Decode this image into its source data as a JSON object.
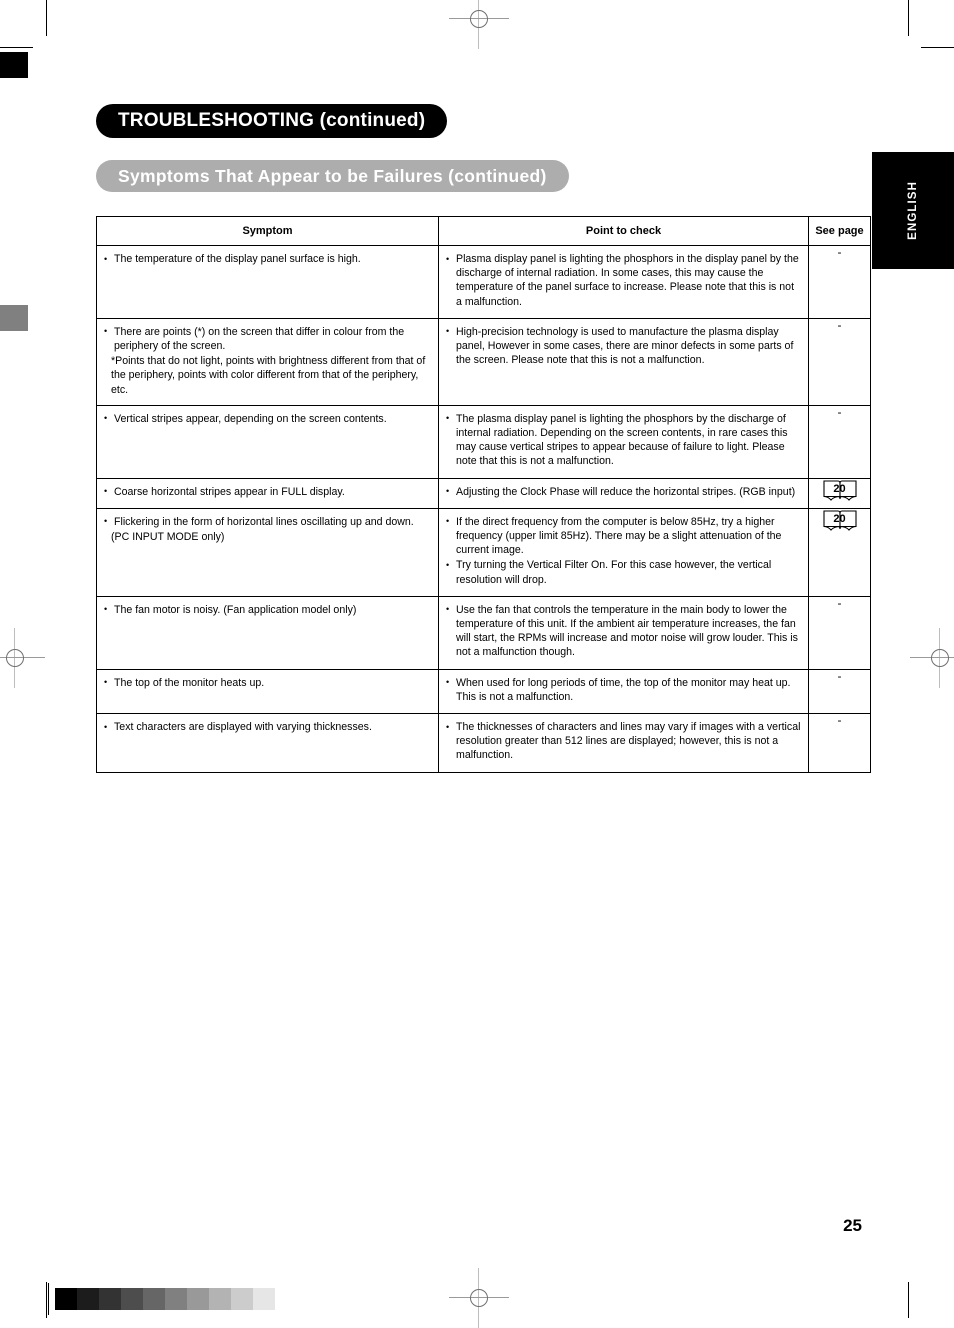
{
  "header": {
    "title": "TROUBLESHOOTING (continued)",
    "subtitle": "Symptoms That Appear to be Failures (continued)"
  },
  "side_tab": {
    "label": "ENGLISH"
  },
  "table": {
    "columns": [
      "Symptom",
      "Point to check",
      "See page"
    ],
    "rows": [
      {
        "symptom": [
          "The temperature of the display panel surface is high."
        ],
        "symptom_notes": [],
        "point": [
          "Plasma display panel is lighting the phosphors in the display panel by the discharge of internal radiation. In some cases, this may cause the temperature of the panel surface to increase. Please note that this is not a malfunction."
        ],
        "page": "-",
        "page_type": "dash"
      },
      {
        "symptom": [
          "There are points (*) on the screen that differ in colour from the periphery of the screen."
        ],
        "symptom_notes": [
          "*Points that do not light, points with brightness different from that of the periphery, points with color different from that of the periphery, etc."
        ],
        "point": [
          "High-precision technology is used to manufacture the plasma display panel, However in some cases, there are minor defects in some parts of the screen. Please note that this is not a malfunction."
        ],
        "page": "-",
        "page_type": "dash"
      },
      {
        "symptom": [
          "Vertical stripes appear, depending on the screen contents."
        ],
        "symptom_notes": [],
        "point": [
          "The plasma display panel is lighting the phosphors by the discharge of internal radiation. Depending on the screen contents, in rare cases this may cause vertical stripes to appear because of failure to light. Please note that this is not a malfunction."
        ],
        "page": "-",
        "page_type": "dash"
      },
      {
        "symptom": [
          "Coarse horizontal stripes appear in FULL display."
        ],
        "symptom_notes": [],
        "point": [
          "Adjusting the Clock Phase will reduce the horizontal stripes. (RGB input)"
        ],
        "page": "20",
        "page_type": "book"
      },
      {
        "symptom": [
          "Flickering in the form of horizontal lines oscillating up and down."
        ],
        "symptom_notes": [
          "(PC INPUT MODE only)"
        ],
        "point": [
          "If the direct frequency from the computer is below 85Hz, try a higher frequency (upper limit 85Hz). There may be a slight attenuation of the current image.",
          "Try turning the Vertical Filter On. For this case however, the vertical resolution will drop."
        ],
        "page": "20",
        "page_type": "book"
      },
      {
        "symptom": [
          "The fan motor is noisy. (Fan application model only)"
        ],
        "symptom_notes": [],
        "point": [
          "Use the fan that controls the temperature in the main body to lower the temperature of this unit. If the ambient air temperature increases, the fan will start, the RPMs will increase and motor noise will grow louder. This is not a malfunction though."
        ],
        "page": "-",
        "page_type": "dash"
      },
      {
        "symptom": [
          "The top of the monitor heats up."
        ],
        "symptom_notes": [],
        "point": [
          "When used for long periods of time, the top of the monitor may heat up. This is not a malfunction."
        ],
        "page": "-",
        "page_type": "dash"
      },
      {
        "symptom": [
          "Text characters are displayed with varying thicknesses."
        ],
        "symptom_notes": [],
        "point": [
          "The thicknesses of characters and lines may vary if images with a vertical resolution greater than 512 lines are displayed; however, this is not a malfunction."
        ],
        "page": "-",
        "page_type": "dash"
      }
    ]
  },
  "footer": {
    "page_number": "25"
  },
  "print_marks": {
    "gray_wedge_steps": [
      "#000000",
      "#1c1c1c",
      "#333333",
      "#4d4d4d",
      "#666666",
      "#808080",
      "#999999",
      "#b3b3b3",
      "#cccccc",
      "#e6e6e6"
    ],
    "left_black_square": "#000000",
    "left_gray_square": "#808080"
  },
  "colors": {
    "title_bg": "#000000",
    "subtitle_bg": "#adadad",
    "tab_bg": "#000000",
    "text": "#000000"
  }
}
